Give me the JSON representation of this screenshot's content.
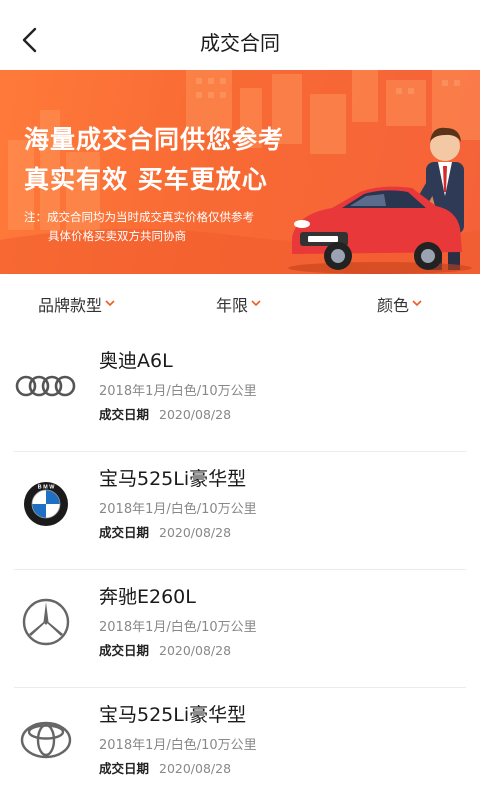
{
  "header": {
    "title": "成交合同",
    "back_icon": "chevron-left-icon"
  },
  "banner": {
    "headline_1": "海量成交合同供您参考",
    "headline_2": "真实有效 买车更放心",
    "note_1": "注：成交合同均为当时成交真实价格仅供参考",
    "note_2": "具体价格买卖双方共同协商",
    "colors": {
      "background": "#f86a34",
      "car": "#e8383a"
    }
  },
  "filters": [
    {
      "label": "品牌款型",
      "icon": "chevron-down-icon"
    },
    {
      "label": "年限",
      "icon": "chevron-down-icon"
    },
    {
      "label": "颜色",
      "icon": "chevron-down-icon"
    }
  ],
  "accent_color": "#f15a24",
  "cars": [
    {
      "brand_logo": "audi-logo-icon",
      "name": "奥迪A6L",
      "specs": "2018年1月/白色/10万公里",
      "deal_label": "成交日期",
      "deal_date": "2020/08/28"
    },
    {
      "brand_logo": "bmw-logo-icon",
      "name": "宝马525Li豪华型",
      "specs": "2018年1月/白色/10万公里",
      "deal_label": "成交日期",
      "deal_date": "2020/08/28"
    },
    {
      "brand_logo": "mercedes-logo-icon",
      "name": "奔驰E260L",
      "specs": "2018年1月/白色/10万公里",
      "deal_label": "成交日期",
      "deal_date": "2020/08/28"
    },
    {
      "brand_logo": "toyota-logo-icon",
      "name": "宝马525Li豪华型",
      "specs": "2018年1月/白色/10万公里",
      "deal_label": "成交日期",
      "deal_date": "2020/08/28"
    }
  ]
}
